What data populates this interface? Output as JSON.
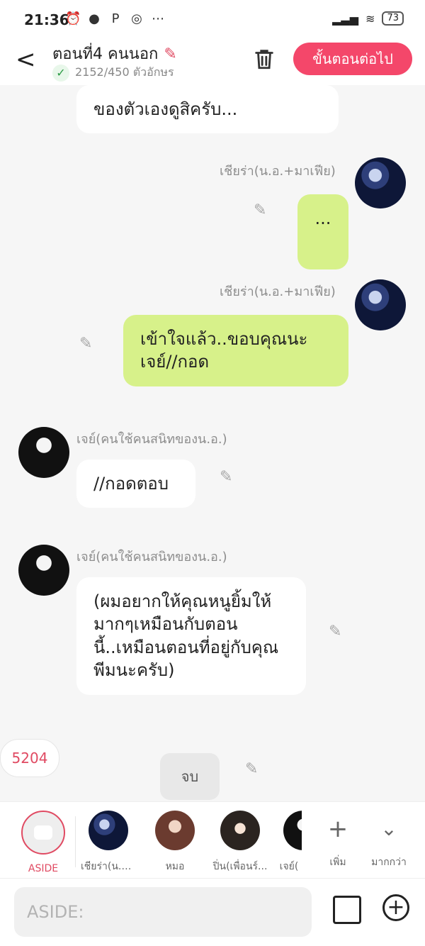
{
  "status": {
    "time": "21:36",
    "battery": "73"
  },
  "header": {
    "back_label": "<",
    "title": "ตอนที่4 คนนอก",
    "word_count": "2152/450 ตัวอักษร",
    "next_label": "ขั้นตอนต่อไป"
  },
  "messages": [
    {
      "id": "m1",
      "text": "ของตัวเองดูสิครับ..."
    },
    {
      "id": "m2",
      "name": "เชียร่า(น.อ.+มาเฟีย)",
      "text": "..."
    },
    {
      "id": "m3",
      "name": "เชียร่า(น.อ.+มาเฟีย)",
      "text": "เข้าใจแล้ว..ขอบคุณนะเจย์//กอด"
    },
    {
      "id": "m4",
      "name": "เจย์(คนใช้คนสนิทของน.อ.)",
      "text": "//กอดตอบ"
    },
    {
      "id": "m5",
      "name": "เจย์(คนใช้คนสนิทของน.อ.)",
      "text": "(ผมอยากให้คุณหนูยิ้มให้มากๆเหมือนกับตอนนี้..เหมือนตอนที่อยู่กับคุณพีมนะครับ)"
    }
  ],
  "counter": "5204",
  "end_label": "จบ",
  "char_bar": {
    "aside_label": "ASIDE",
    "characters": [
      {
        "label": "เชียร่า(น.อ..."
      },
      {
        "label": "หมอ"
      },
      {
        "label": "ปิ่น(เพื่อนร์..."
      },
      {
        "label": "เจย์("
      }
    ],
    "add_label": "เพิ่ม",
    "more_label": "มากกว่า"
  },
  "input": {
    "placeholder": "ASIDE:"
  }
}
